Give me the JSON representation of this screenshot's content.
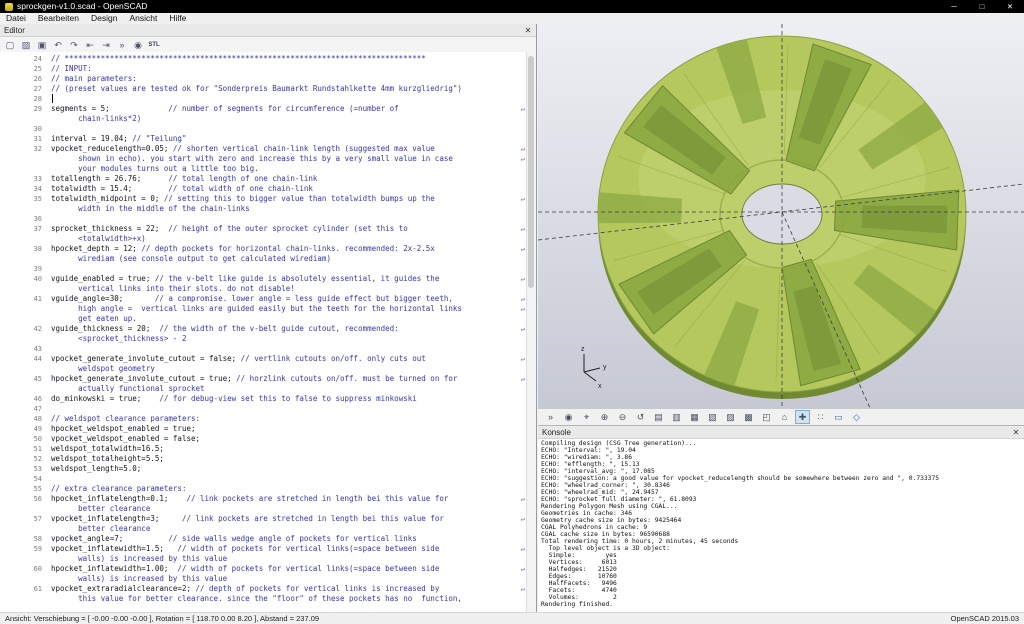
{
  "window": {
    "title": "sprockgen-v1.0.scad - OpenSCAD",
    "controls": {
      "minimize": "─",
      "maximize": "□",
      "close": "✕"
    }
  },
  "menu": {
    "items": [
      "Datei",
      "Bearbeiten",
      "Design",
      "Ansicht",
      "Hilfe"
    ]
  },
  "editor": {
    "panel_title": "Editor",
    "close_glyph": "✕",
    "wrap_glyph": "↵",
    "toolbar": [
      {
        "name": "new-file-button",
        "glyph": "▢"
      },
      {
        "name": "open-file-button",
        "glyph": "▨"
      },
      {
        "name": "save-file-button",
        "glyph": "▣"
      },
      {
        "name": "undo-button",
        "glyph": "↶"
      },
      {
        "name": "redo-button",
        "glyph": "↷"
      },
      {
        "name": "unindent-button",
        "glyph": "⇤"
      },
      {
        "name": "indent-button",
        "glyph": "⇥"
      },
      {
        "name": "preview-button",
        "glyph": "»"
      },
      {
        "name": "render-button",
        "glyph": "◉"
      },
      {
        "name": "export-stl-button",
        "glyph": "STL",
        "cls": "stl"
      }
    ],
    "rows": [
      [
        "24",
        "",
        "// ********************************************************************************",
        0
      ],
      [
        "25",
        "",
        "// INPUT:",
        0
      ],
      [
        "26",
        "",
        "// main parameters:",
        0
      ],
      [
        "27",
        "",
        "// (preset values are tested ok for \"Sonderpreis Baumarkt Rundstahlkette 4mm kurzgliedrig\")",
        0
      ],
      [
        "28",
        "",
        "",
        0
      ],
      [
        "29",
        "segments = 5;",
        "             // number of segments for circumference (=number of",
        1
      ],
      [
        "",
        "",
        "      chain-links*2)",
        0
      ],
      [
        "30",
        "",
        "",
        0
      ],
      [
        "31",
        "interval = 19.04;",
        " // \"Teilung\"",
        0
      ],
      [
        "32",
        "vpocket_reducelength=0.05;",
        " // shorten vertical chain-link length (suggested max value",
        1
      ],
      [
        "",
        "",
        "      shown in echo). you start with zero and increase this by a very small value in case",
        1
      ],
      [
        "",
        "",
        "      your modules turns out a little too big.",
        0
      ],
      [
        "33",
        "totallength = 26.76;",
        "      // total length of one chain-link",
        0
      ],
      [
        "34",
        "totalwidth = 15.4;",
        "        // total width of one chain-link",
        0
      ],
      [
        "35",
        "totalwidth_midpoint = 0;",
        " // setting this to bigger value than totalwidth bumps up the",
        1
      ],
      [
        "",
        "",
        "      width in the middle of the chain-links",
        0
      ],
      [
        "36",
        "",
        "",
        0
      ],
      [
        "37",
        "sprocket_thickness = 22;",
        "  // height of the outer sprocket cylinder (set this to",
        1
      ],
      [
        "",
        "",
        "      <totalwidth>+x)",
        0
      ],
      [
        "38",
        "hpocket_depth = 12;",
        " // depth pockets for horizontal chain-links. recommended: 2x-2.5x",
        1
      ],
      [
        "",
        "",
        "      wirediam (see console output to get calculated wirediam)",
        0
      ],
      [
        "39",
        "",
        "",
        0
      ],
      [
        "40",
        "vguide_enabled = true;",
        " // the v-belt like guide is absolutely essential, it guides the",
        1
      ],
      [
        "",
        "",
        "      vertical links into their slots. do not disable!",
        0
      ],
      [
        "41",
        "vguide_angle=30;",
        "       // a compromise. lower angle = less guide effect but bigger teeth,",
        1
      ],
      [
        "",
        "",
        "      high angle =  vertical links are guided easily but the teeth for the horizontal links",
        1
      ],
      [
        "",
        "",
        "      get eaten up.",
        0
      ],
      [
        "42",
        "vguide_thickness = 20;",
        "  // the width of the v-belt guide cutout, recommended:",
        1
      ],
      [
        "",
        "",
        "      <sprocket_thickness> - 2",
        0
      ],
      [
        "43",
        "",
        "",
        0
      ],
      [
        "44",
        "vpocket_generate_involute_cutout = false;",
        " // vertlink cutouts on/off. only cuts out",
        1
      ],
      [
        "",
        "",
        "      weldspot geometry",
        0
      ],
      [
        "45",
        "hpocket_generate_involute_cutout = true;",
        " // horzlink cutouts on/off. must be turned on for",
        1
      ],
      [
        "",
        "",
        "      actually functional sprocket",
        0
      ],
      [
        "46",
        "do_minkowski = true;",
        "    // for debug-view set this to false to suppress minkowski",
        0
      ],
      [
        "47",
        "",
        "",
        0
      ],
      [
        "48",
        "",
        "// weldspot clearance parameters:",
        0
      ],
      [
        "49",
        "hpocket_weldspot_enabled = true;",
        "",
        0
      ],
      [
        "50",
        "vpocket_weldspot_enabled = false;",
        "",
        0
      ],
      [
        "51",
        "weldspot_totalwidth=16.5;",
        "",
        0
      ],
      [
        "52",
        "weldspot_totalheight=5.5;",
        "",
        0
      ],
      [
        "53",
        "weldspot_length=5.0;",
        "",
        0
      ],
      [
        "54",
        "",
        "",
        0
      ],
      [
        "55",
        "",
        "// extra clearance parameters:",
        0
      ],
      [
        "56",
        "hpocket_inflatelength=0.1;",
        "    // link pockets are stretched in length bei this value for",
        1
      ],
      [
        "",
        "",
        "      better clearance",
        0
      ],
      [
        "57",
        "vpocket_inflatelength=3;",
        "     // link pockets are stretched in length bei this value for",
        1
      ],
      [
        "",
        "",
        "      better clearance",
        0
      ],
      [
        "58",
        "vpocket_angle=7;",
        "          // side walls wedge angle of pockets for vertical links",
        0
      ],
      [
        "59",
        "vpocket_inflatewidth=1.5;",
        "   // width of pockets for vertical links(=space between side",
        1
      ],
      [
        "",
        "",
        "      walls) is increased by this value",
        0
      ],
      [
        "60",
        "hpocket_inflatewidth=1.00;",
        "  // width of pockets for vertical links(=space between side",
        1
      ],
      [
        "",
        "",
        "      walls) is increased by this value",
        0
      ],
      [
        "61",
        "vpocket_extraradialclearance=2;",
        " // depth of pockets for vertical links is increased by",
        1
      ],
      [
        "",
        "",
        "      this value for better clearance. since the \"floor\" of these pockets has no  function,",
        0
      ]
    ]
  },
  "viewport": {
    "axis_labels": {
      "x": "x",
      "y": "y",
      "z": "z"
    },
    "colors": {
      "bg_top": "#edeff3",
      "bg_bottom": "#c6c9d4",
      "model_base": "#b4c85e",
      "model_light": "#d4e08c",
      "model_dark": "#6f8a33",
      "model_edge": "#8ba244",
      "pocket": "#8fab44",
      "pocket_deep": "#7b9639",
      "pocket_edge": "#6d8733",
      "hole": "#d9dce3",
      "hole_edge": "#6b7f38"
    },
    "toolbar": [
      {
        "name": "view-preview-button",
        "glyph": "»"
      },
      {
        "name": "view-render-button",
        "glyph": "◉"
      },
      {
        "name": "zoom-all-button",
        "glyph": "⌖"
      },
      {
        "name": "zoom-in-button",
        "glyph": "⊕"
      },
      {
        "name": "zoom-out-button",
        "glyph": "⊖"
      },
      {
        "name": "view-reset-button",
        "glyph": "↺"
      },
      {
        "name": "view-right-button",
        "glyph": "▤"
      },
      {
        "name": "view-top-button",
        "glyph": "▥"
      },
      {
        "name": "view-bottom-button",
        "glyph": "▦"
      },
      {
        "name": "view-left-button",
        "glyph": "▧"
      },
      {
        "name": "view-front-button",
        "glyph": "▨"
      },
      {
        "name": "view-back-button",
        "glyph": "▩"
      },
      {
        "name": "view-diagonal-button",
        "glyph": "◰"
      },
      {
        "name": "view-center-button",
        "glyph": "⌂"
      },
      {
        "name": "show-axes-button",
        "glyph": "✚",
        "pressed": true
      },
      {
        "name": "show-scale-markers-button",
        "glyph": "∷"
      },
      {
        "name": "orthogonal-view-button",
        "glyph": "▭",
        "blue": true
      },
      {
        "name": "perspective-view-button",
        "glyph": "◇",
        "blue": true
      }
    ]
  },
  "console": {
    "panel_title": "Konsole",
    "close_glyph": "✕",
    "lines": [
      "Compiling design (CSG Tree generation)...",
      "ECHO: \"Interval: \", 19.04",
      "ECHO: \"wirediam: \", 3.86",
      "ECHO: \"efflength: \", 15.13",
      "ECHO: \"interval_avg: \", 17.085",
      "ECHO: \"suggestion: a good value for vpocket_reducelength should be somewhere between zero and \", 0.733375",
      "ECHO: \"wheelrad_corner: \", 30.8346",
      "ECHO: \"wheelrad_mid: \", 24.9457",
      "ECHO: \"sprocket full diameter: \", 61.8093",
      "Rendering Polygon Mesh using CGAL...",
      "Geometries in cache: 346",
      "Geometry cache size in bytes: 9425464",
      "CGAL Polyhedrons in cache: 9",
      "CGAL cache size in bytes: 96590688",
      "Total rendering time: 0 hours, 2 minutes, 45 seconds",
      "  Top level object is a 3D object:",
      "  Simple:        yes",
      "  Vertices:     6013",
      "  Halfedges:   21520",
      "  Edges:       10760",
      "  HalfFacets:   9496",
      "  Facets:       4740",
      "  Volumes:         2",
      "Rendering finished."
    ]
  },
  "statusbar": {
    "left": "Ansicht: Verschiebung = [ -0.00 -0.00 -0.00 ], Rotation = [ 118.70 0.00 8.20 ], Abstand = 237.09",
    "right": "OpenSCAD 2015.03"
  }
}
